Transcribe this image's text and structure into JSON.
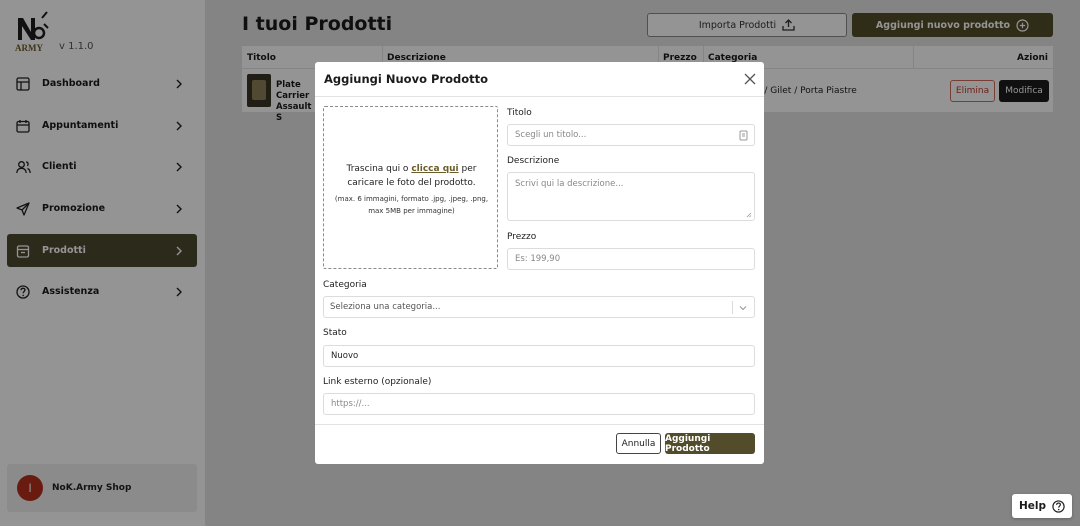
{
  "sidebar": {
    "version": "v 1.1.0",
    "items": [
      {
        "label": "Dashboard",
        "icon": "dashboard-icon"
      },
      {
        "label": "Appuntamenti",
        "icon": "calendar-icon"
      },
      {
        "label": "Clienti",
        "icon": "users-icon"
      },
      {
        "label": "Promozione",
        "icon": "send-icon"
      },
      {
        "label": "Prodotti",
        "icon": "box-icon",
        "active": true
      },
      {
        "label": "Assistenza",
        "icon": "help-circle-icon"
      }
    ],
    "shop": {
      "initial": "I",
      "name": "NoK.Army Shop"
    }
  },
  "main": {
    "title": "I tuoi Prodotti",
    "import_label": "Importa Prodotti",
    "add_label": "Aggiungi nuovo prodotto",
    "table": {
      "headers": [
        "Titolo",
        "Descrizione",
        "Prezzo",
        "Categoria",
        "Azioni"
      ],
      "rows": [
        {
          "title": "Plate Carrier Assault S",
          "category": "Tattico / Gilet / Porta Piastre",
          "delete_label": "Elimina",
          "edit_label": "Modifica"
        }
      ]
    }
  },
  "modal": {
    "title": "Aggiungi Nuovo Prodotto",
    "dropzone": {
      "text_before": "Trascina qui o ",
      "link": "clicca qui",
      "text_after": " per caricare le foto del prodotto.",
      "note": "(max. 6 immagini, formato .jpg, .jpeg, .png, max 5MB per immagine)"
    },
    "fields": {
      "title_label": "Titolo",
      "title_placeholder": "Scegli un titolo...",
      "description_label": "Descrizione",
      "description_placeholder": "Scrivi qui la descrizione...",
      "price_label": "Prezzo",
      "price_placeholder": "Es: 199,90",
      "category_label": "Categoria",
      "category_placeholder": "Seleziona una categoria...",
      "status_label": "Stato",
      "status_value": "Nuovo",
      "link_label": "Link esterno (opzionale)",
      "link_placeholder": "https://..."
    },
    "cancel_label": "Annulla",
    "submit_label": "Aggiungi Prodotto"
  },
  "help_label": "Help",
  "colors": {
    "accent": "#524c2a",
    "danger": "#c0392b",
    "avatar": "#b5301c"
  }
}
